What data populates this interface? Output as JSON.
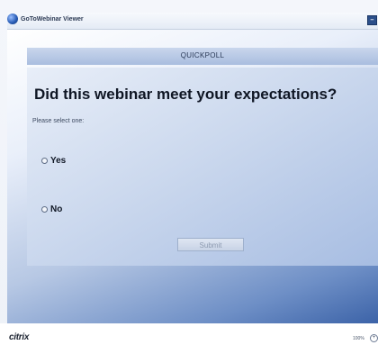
{
  "window": {
    "title": "GoToWebinar Viewer",
    "minimize_glyph": "–",
    "close_glyph": "□"
  },
  "poll": {
    "header": "QUICKPOLL",
    "question": "Did this webinar meet your expectations?",
    "instruction": "Please select one:",
    "options": [
      {
        "label": "Yes",
        "selected": false
      },
      {
        "label": "No",
        "selected": false
      }
    ],
    "submit_label": "Submit",
    "submit_enabled": false
  },
  "footer": {
    "brand": "citrix",
    "zoom": "100%",
    "zoom_glyph": "+"
  },
  "icons": {
    "app": "globe-icon",
    "zoom": "zoom-icon",
    "radio": "radio-icon"
  }
}
